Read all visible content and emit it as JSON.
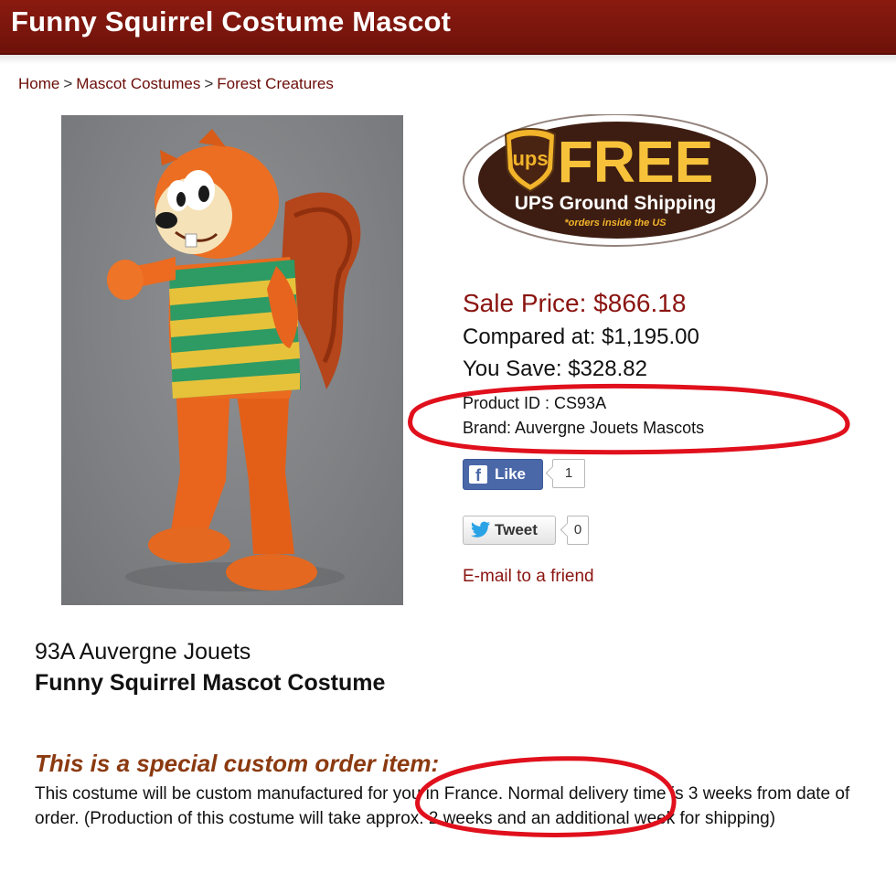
{
  "header": {
    "title": "Funny Squirrel Costume Mascot"
  },
  "breadcrumb": {
    "items": [
      "Home",
      "Mascot Costumes",
      "Forest Creatures"
    ],
    "separator": ">"
  },
  "product_image": {
    "subject": "squirrel mascot costume",
    "background": "#7f8184"
  },
  "shipping_badge": {
    "logo_text": "ups",
    "headline": "FREE",
    "line1": "UPS Ground Shipping",
    "line2": "*orders inside the US"
  },
  "pricing": {
    "sale": "Sale Price: $866.18",
    "compared": "Compared at: $1,195.00",
    "save": "You Save: $328.82"
  },
  "details": {
    "product_id": "Product ID : CS93A",
    "brand": "Brand: Auvergne Jouets Mascots"
  },
  "social": {
    "like_label": "Like",
    "like_count": "1",
    "tweet_label": "Tweet",
    "tweet_count": "0"
  },
  "email_link": "E-mail to a friend",
  "product": {
    "subtitle": "93A Auvergne Jouets",
    "title": "Funny Squirrel Mascot Costume"
  },
  "custom_order": {
    "heading": "This is a special custom order item:",
    "body": "This costume will be custom manufactured for you in France. Normal delivery time is 3 weeks from date of order. (Production of this costume will take approx. 2 weeks and an additional week for shipping)"
  },
  "colors": {
    "header": "#7a150c",
    "accent": "#8a1410",
    "annotation": "#e0101c"
  }
}
